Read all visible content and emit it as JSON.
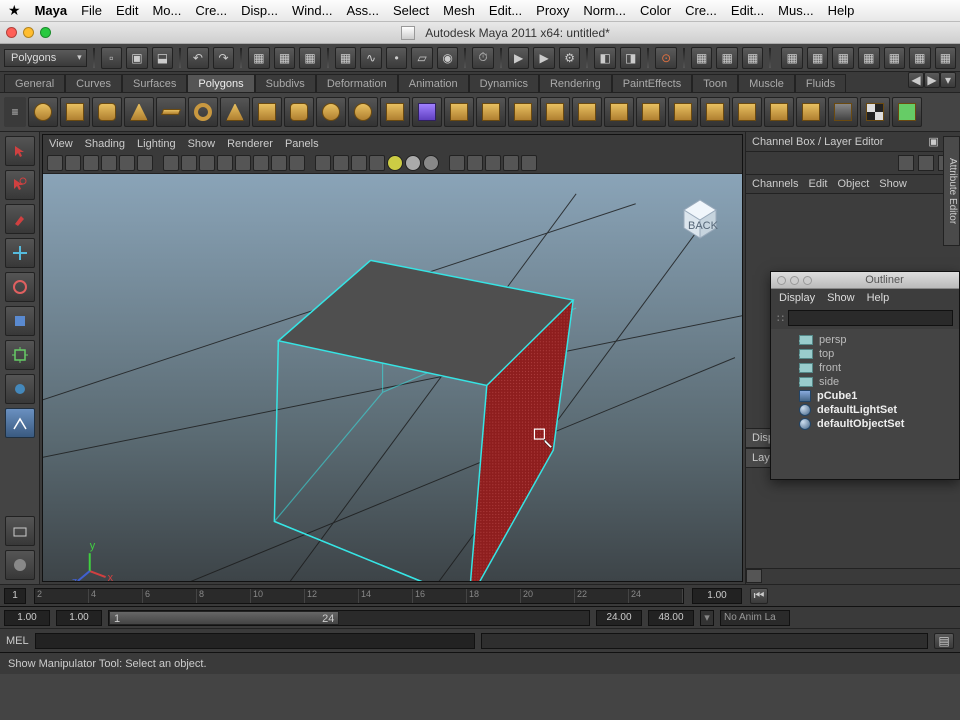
{
  "mac_menu": {
    "app": "Maya",
    "items": [
      "File",
      "Edit",
      "Mo...",
      "Cre...",
      "Disp...",
      "Wind...",
      "Ass...",
      "Select",
      "Mesh",
      "Edit...",
      "Proxy",
      "Norm...",
      "Color",
      "Cre...",
      "Edit...",
      "Mus...",
      "Help"
    ]
  },
  "window": {
    "title": "Autodesk Maya 2011 x64: untitled*"
  },
  "module_dropdown": "Polygons",
  "shelf_tabs": [
    "General",
    "Curves",
    "Surfaces",
    "Polygons",
    "Subdivs",
    "Deformation",
    "Animation",
    "Dynamics",
    "Rendering",
    "PaintEffects",
    "Toon",
    "Muscle",
    "Fluids"
  ],
  "shelf_active": "Polygons",
  "viewport_menus": [
    "View",
    "Shading",
    "Lighting",
    "Show",
    "Renderer",
    "Panels"
  ],
  "viewcube_face": "BACK",
  "channel_box": {
    "title": "Channel Box / Layer Editor",
    "tabs": [
      "Channels",
      "Edit",
      "Object",
      "Show"
    ],
    "display": "Displa",
    "layers": "Layers"
  },
  "attr_tab": "Attribute Editor",
  "outliner": {
    "title": "Outliner",
    "menus": [
      "Display",
      "Show",
      "Help"
    ],
    "items": [
      {
        "label": "persp",
        "kind": "camera"
      },
      {
        "label": "top",
        "kind": "camera"
      },
      {
        "label": "front",
        "kind": "camera"
      },
      {
        "label": "side",
        "kind": "camera"
      },
      {
        "label": "pCube1",
        "kind": "mesh",
        "bold": true
      },
      {
        "label": "defaultLightSet",
        "kind": "set",
        "bold": true
      },
      {
        "label": "defaultObjectSet",
        "kind": "set",
        "bold": true
      }
    ]
  },
  "time": {
    "ticks": [
      "2",
      "4",
      "6",
      "8",
      "10",
      "12",
      "14",
      "16",
      "18",
      "20",
      "22",
      "24"
    ],
    "cur_left": "1",
    "cur_right": "1.00",
    "play_end": ""
  },
  "range": {
    "start": "1.00",
    "anim_start": "1.00",
    "handle_start": "1",
    "handle_end": "24",
    "anim_end": "24.00",
    "end": "48.00",
    "layer": "No Anim La"
  },
  "cmd": {
    "label": "MEL"
  },
  "helpline": "Show Manipulator Tool: Select an object.",
  "colors": {
    "wire": "#36e4e4",
    "selected_face": "#8e1e1e",
    "axis_x": "#d04040",
    "axis_y": "#40d040",
    "axis_z": "#4060d0"
  }
}
